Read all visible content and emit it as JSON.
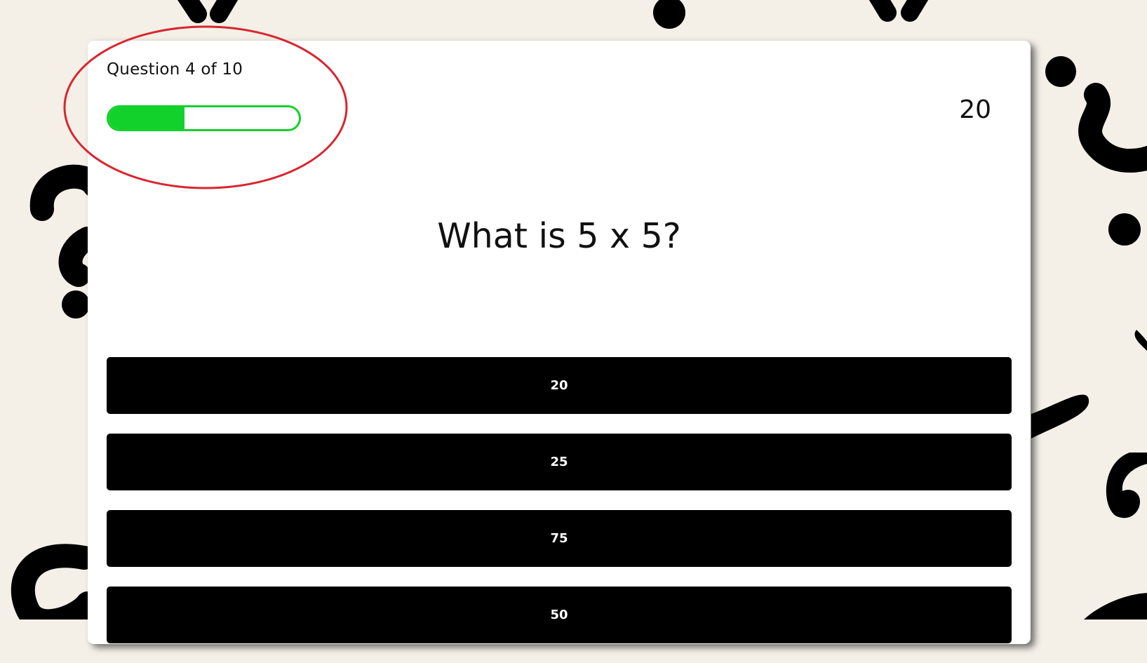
{
  "quiz": {
    "progress_text": "Question 4 of 10",
    "progress_fraction": 0.4,
    "timer": "20",
    "question": "What is 5 x 5?",
    "answers": [
      {
        "label": "20"
      },
      {
        "label": "25"
      },
      {
        "label": "75"
      },
      {
        "label": "50"
      }
    ]
  },
  "colors": {
    "background": "#f4f0e8",
    "progress_green": "#13d12b",
    "answer_button": "#000000",
    "annotation": "#d9252f"
  }
}
